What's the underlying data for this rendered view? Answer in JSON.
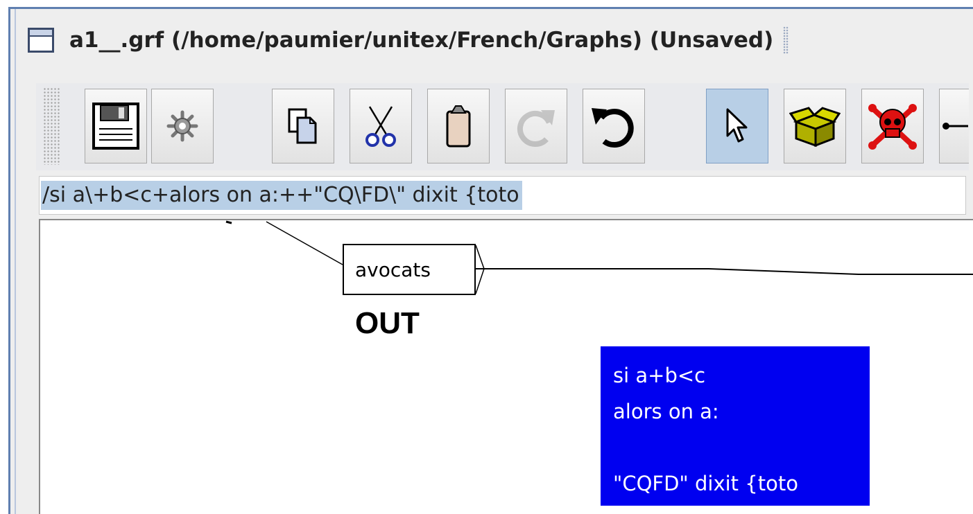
{
  "window": {
    "title": "a1__.grf (/home/paumier/unitex/French/Graphs) (Unsaved)"
  },
  "toolbar": {
    "buttons": [
      {
        "name": "save",
        "icon": "floppy-disk-icon"
      },
      {
        "name": "compile",
        "icon": "gear-icon"
      },
      {
        "name": "copy",
        "icon": "copy-icon"
      },
      {
        "name": "cut",
        "icon": "scissors-icon"
      },
      {
        "name": "paste",
        "icon": "clipboard-icon"
      },
      {
        "name": "redo",
        "icon": "redo-icon",
        "disabled": true
      },
      {
        "name": "undo",
        "icon": "undo-icon"
      },
      {
        "name": "normal-mode",
        "icon": "arrow-cursor-icon",
        "selected": true
      },
      {
        "name": "open-subgraph",
        "icon": "box-icon"
      },
      {
        "name": "delete",
        "icon": "skull-crossbones-icon"
      },
      {
        "name": "link",
        "icon": "link-arrow-icon"
      }
    ]
  },
  "box_input": {
    "value": "/si a\\+b<c+alors on a:++\"CQ\\FD\\\" dixit {toto"
  },
  "graph": {
    "box_label": "avocats",
    "output_label": "OUT",
    "comment_lines": [
      "si a+b<c",
      "alors on a:",
      "",
      "\"CQFD\" dixit {toto"
    ]
  },
  "colors": {
    "comment_background": "#0000f0",
    "selection": "#b8cfe6",
    "frame": "#5f7fb0"
  }
}
